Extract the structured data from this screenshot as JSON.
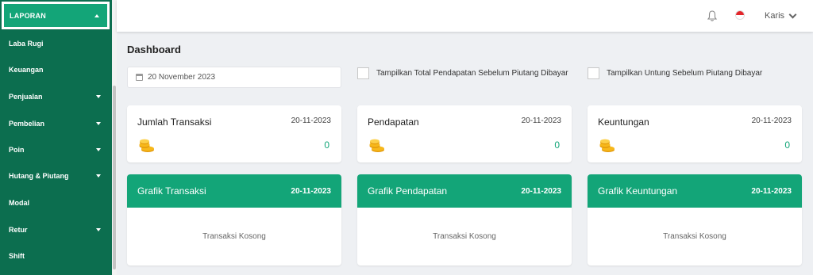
{
  "sidebar": {
    "header": "LAPORAN",
    "items": [
      {
        "label": "Laba Rugi"
      },
      {
        "label": "Keuangan"
      },
      {
        "label": "Penjualan"
      },
      {
        "label": "Pembelian"
      },
      {
        "label": "Poin"
      },
      {
        "label": "Hutang & Piutang"
      },
      {
        "label": "Modal"
      },
      {
        "label": "Retur"
      },
      {
        "label": "Shift"
      }
    ]
  },
  "topbar": {
    "user": "Karis",
    "bell_icon": "bell-icon",
    "flag_icon": "indonesia-flag-icon"
  },
  "main": {
    "title": "Dashboard",
    "date": "20 November 2023",
    "checkbox1": "Tampilkan Total Pendapatan Sebelum Piutang Dibayar",
    "checkbox2": "Tampilkan Untung Sebelum Piutang Dibayar",
    "stats": [
      {
        "title": "Jumlah Transaksi",
        "date": "20-11-2023",
        "value": "0"
      },
      {
        "title": "Pendapatan",
        "date": "20-11-2023",
        "value": "0"
      },
      {
        "title": "Keuntungan",
        "date": "20-11-2023",
        "value": "0"
      }
    ],
    "charts": [
      {
        "title": "Grafik Transaksi",
        "date": "20-11-2023",
        "empty": "Transaksi Kosong"
      },
      {
        "title": "Grafik Pendapatan",
        "date": "20-11-2023",
        "empty": "Transaksi Kosong"
      },
      {
        "title": "Grafik Keuntungan",
        "date": "20-11-2023",
        "empty": "Transaksi Kosong"
      }
    ]
  },
  "colors": {
    "sidebar": "#0c6e4f",
    "accent": "#13a578"
  }
}
